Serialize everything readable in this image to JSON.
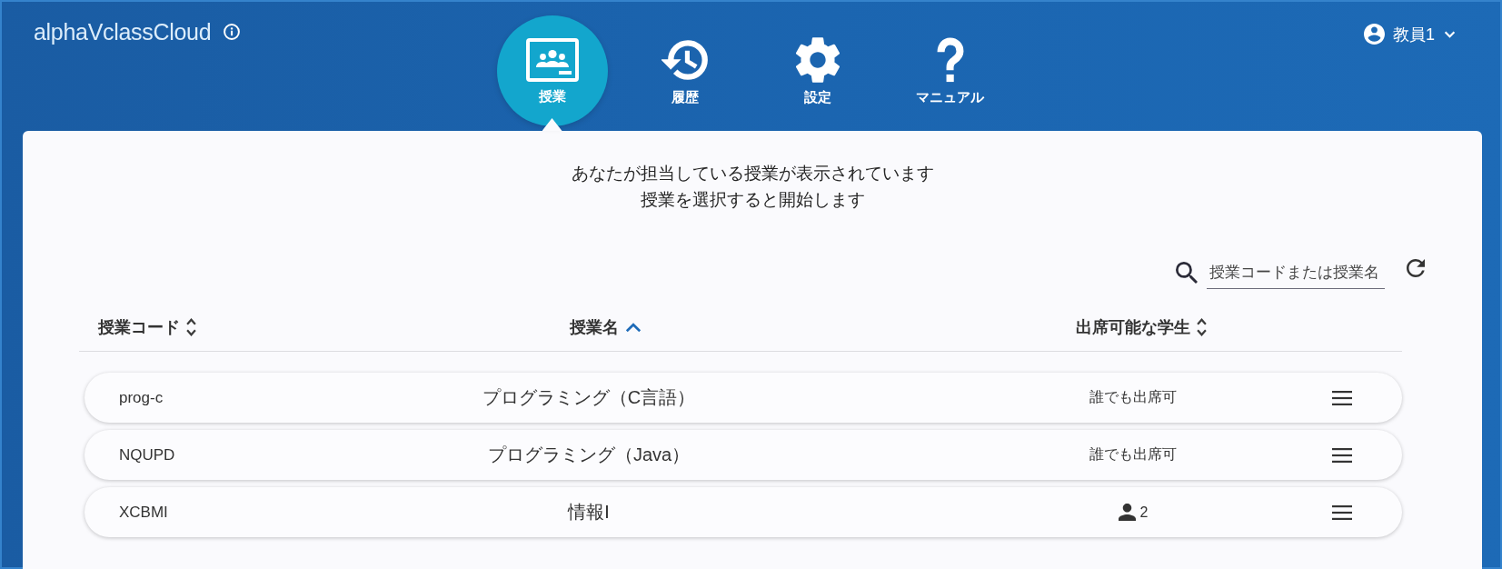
{
  "header": {
    "logo": "alphaVclassCloud",
    "nav": [
      {
        "label": "授業",
        "selected": true
      },
      {
        "label": "履歴",
        "selected": false
      },
      {
        "label": "設定",
        "selected": false
      },
      {
        "label": "マニュアル",
        "selected": false
      }
    ],
    "user": {
      "name": "教員1"
    }
  },
  "intro": [
    "あなたが担当している授業が表示されています",
    "授業を選択すると開始します"
  ],
  "search": {
    "placeholder": "授業コードまたは授業名"
  },
  "table": {
    "columns": [
      {
        "label": "授業コード",
        "sorted": false
      },
      {
        "label": "授業名",
        "sorted": true
      },
      {
        "label": "出席可能な学生",
        "sorted": false
      }
    ],
    "rows": [
      {
        "code": "prog-c",
        "name": "プログラミング（C言語）",
        "attendance": {
          "kind": "text",
          "text": "誰でも出席可"
        }
      },
      {
        "code": "NQUPD",
        "name": "プログラミング（Java）",
        "attendance": {
          "kind": "text",
          "text": "誰でも出席可"
        }
      },
      {
        "code": "XCBMI",
        "name": "情報Ⅰ",
        "attendance": {
          "kind": "count",
          "text": "2"
        }
      }
    ]
  }
}
